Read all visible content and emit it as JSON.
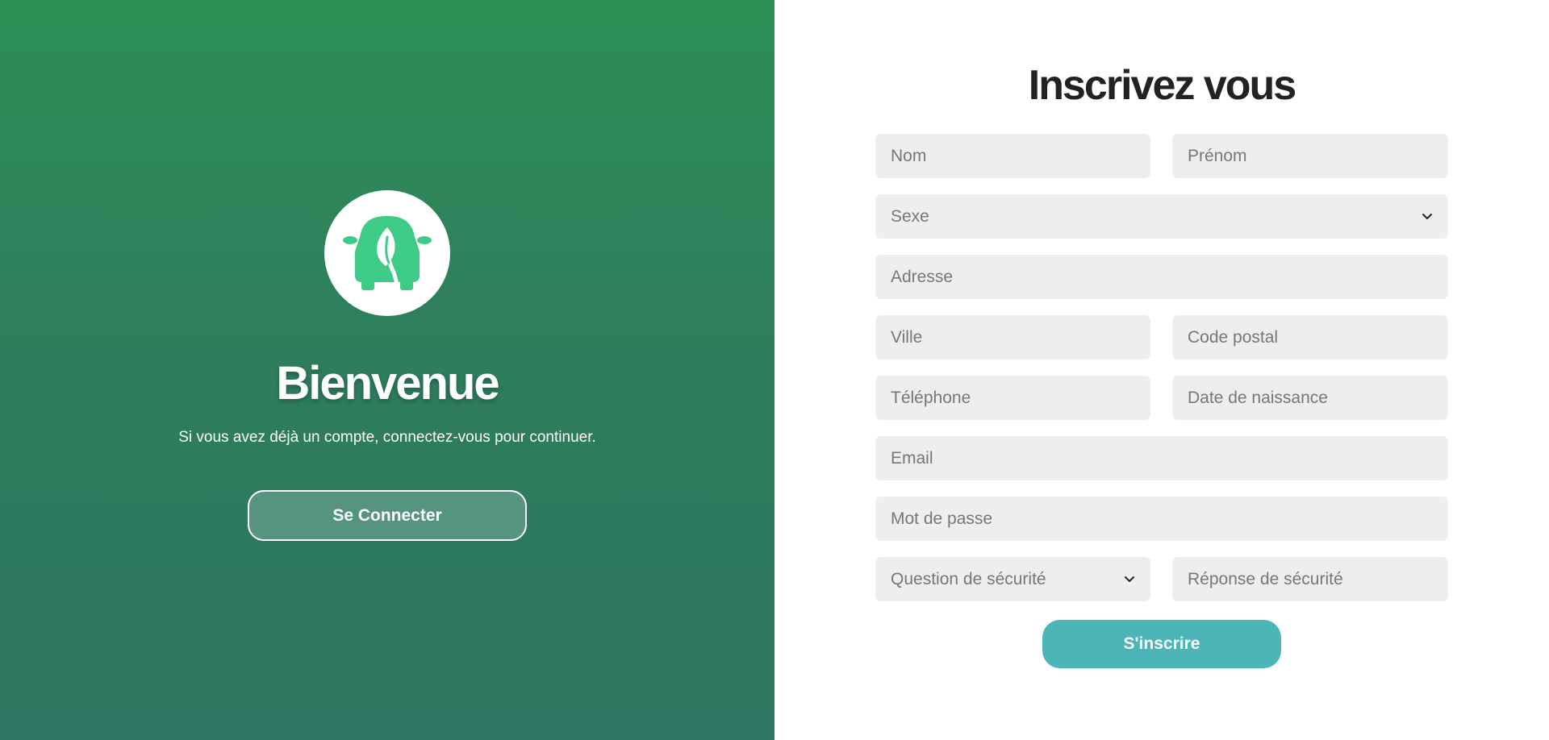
{
  "welcome": {
    "title": "Bienvenue",
    "subtitle": "Si vous avez déjà un compte, connectez-vous pour continuer.",
    "login_label": "Se Connecter",
    "logo_icon": "car-leaf-icon"
  },
  "form": {
    "title": "Inscrivez vous",
    "nom_placeholder": "Nom",
    "prenom_placeholder": "Prénom",
    "sexe_label": "Sexe",
    "adresse_placeholder": "Adresse",
    "ville_placeholder": "Ville",
    "code_postal_placeholder": "Code postal",
    "telephone_placeholder": "Téléphone",
    "date_naissance_placeholder": "Date de naissance",
    "email_placeholder": "Email",
    "mot_de_passe_placeholder": "Mot de passe",
    "question_securite_label": "Question de sécurité",
    "reponse_securite_placeholder": "Réponse de sécurité",
    "submit_label": "S'inscrire"
  },
  "colors": {
    "left_panel_top": "#2d8f55",
    "left_panel_bottom": "#2e7661",
    "logo_green": "#3ecb87",
    "submit_button": "#4cb5b8",
    "field_background": "#eeeeee"
  }
}
